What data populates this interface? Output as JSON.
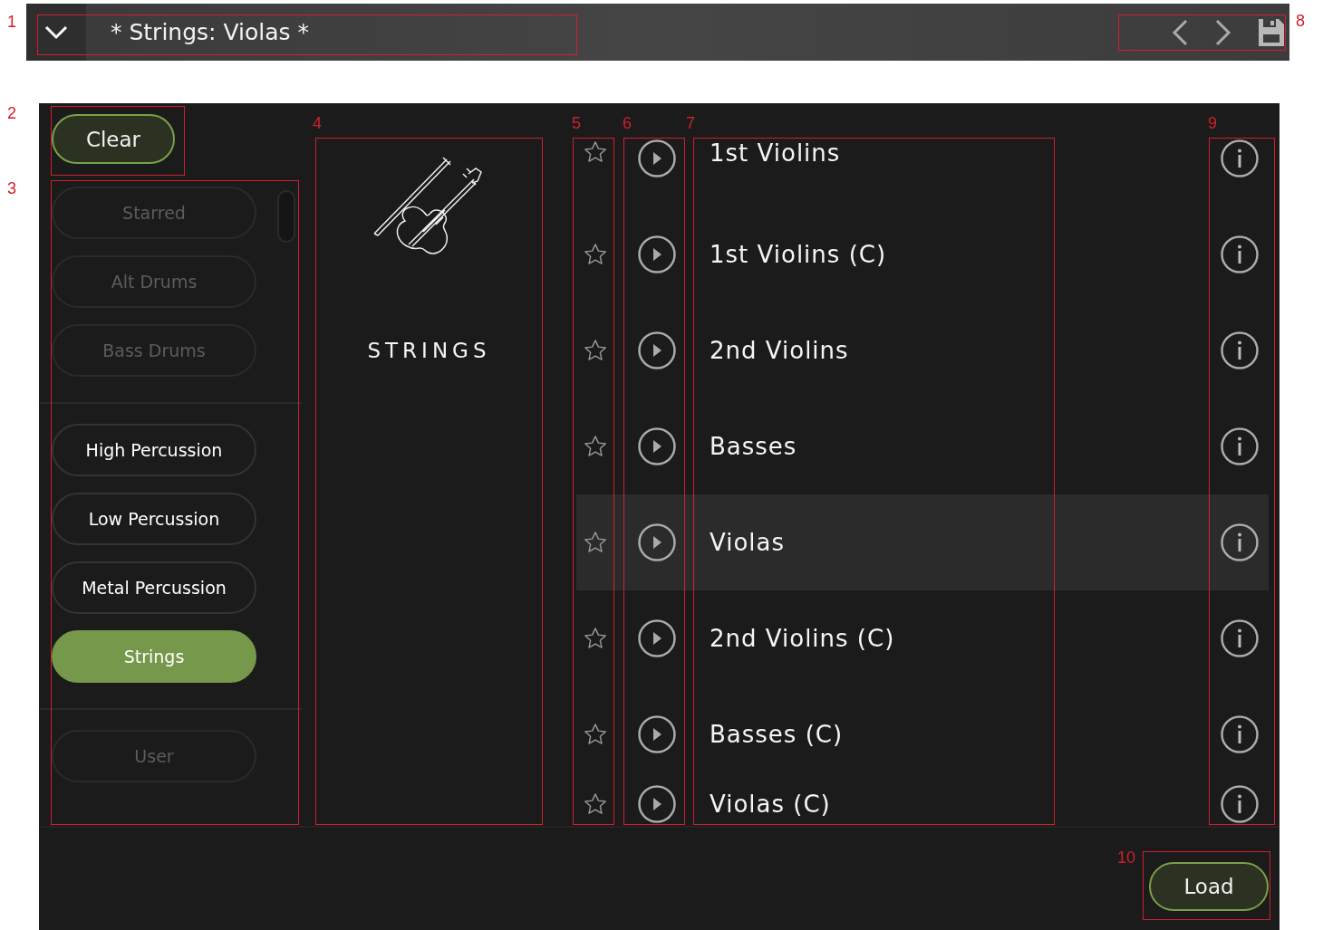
{
  "header": {
    "title": "* Strings: Violas *"
  },
  "clear_button": {
    "label": "Clear"
  },
  "categories": {
    "groups": [
      {
        "items": [
          {
            "label": "Starred",
            "disabled": true,
            "selected": false
          },
          {
            "label": "Alt Drums",
            "disabled": true,
            "selected": false
          },
          {
            "label": "Bass Drums",
            "disabled": true,
            "selected": false
          }
        ]
      },
      {
        "items": [
          {
            "label": "High Percussion",
            "disabled": false,
            "selected": false
          },
          {
            "label": "Low Percussion",
            "disabled": false,
            "selected": false
          },
          {
            "label": "Metal Percussion",
            "disabled": false,
            "selected": false
          },
          {
            "label": "Strings",
            "disabled": false,
            "selected": true
          }
        ]
      },
      {
        "items": [
          {
            "label": "User",
            "disabled": true,
            "selected": false
          }
        ]
      }
    ]
  },
  "category_panel": {
    "title": "STRINGS"
  },
  "presets": [
    {
      "name": "1st Violins",
      "selected": false,
      "starred": false
    },
    {
      "name": "1st Violins (C)",
      "selected": false,
      "starred": false
    },
    {
      "name": "2nd Violins",
      "selected": false,
      "starred": false
    },
    {
      "name": "Basses",
      "selected": false,
      "starred": false
    },
    {
      "name": "Violas",
      "selected": true,
      "starred": false
    },
    {
      "name": "2nd Violins (C)",
      "selected": false,
      "starred": false
    },
    {
      "name": "Basses (C)",
      "selected": false,
      "starred": false
    },
    {
      "name": "Violas (C)",
      "selected": false,
      "starred": false
    }
  ],
  "load_button": {
    "label": "Load"
  },
  "annotations": [
    {
      "label": "1"
    },
    {
      "label": "2"
    },
    {
      "label": "3"
    },
    {
      "label": "4"
    },
    {
      "label": "5"
    },
    {
      "label": "6"
    },
    {
      "label": "7"
    },
    {
      "label": "8"
    },
    {
      "label": "9"
    },
    {
      "label": "10"
    }
  ]
}
